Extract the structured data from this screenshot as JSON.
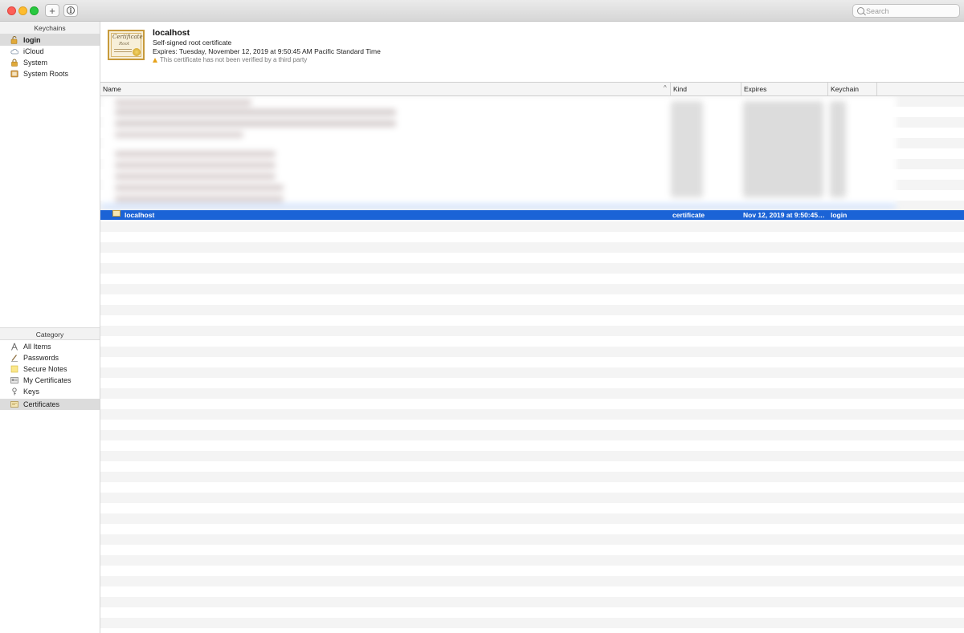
{
  "titlebar": {
    "search_placeholder": "Search"
  },
  "sidebar": {
    "keychains_header": "Keychains",
    "keychains": [
      {
        "label": "login",
        "icon": "lock-open-icon",
        "selected": true
      },
      {
        "label": "iCloud",
        "icon": "cloud-icon",
        "selected": false
      },
      {
        "label": "System",
        "icon": "lock-icon",
        "selected": false
      },
      {
        "label": "System Roots",
        "icon": "cabinet-icon",
        "selected": false
      }
    ],
    "category_header": "Category",
    "categories": [
      {
        "label": "All Items",
        "icon": "all-items-icon",
        "selected": false
      },
      {
        "label": "Passwords",
        "icon": "pen-icon",
        "selected": false
      },
      {
        "label": "Secure Notes",
        "icon": "note-icon",
        "selected": false
      },
      {
        "label": "My Certificates",
        "icon": "id-card-icon",
        "selected": false
      },
      {
        "label": "Keys",
        "icon": "key-icon",
        "selected": false
      },
      {
        "label": "Certificates",
        "icon": "certificate-icon",
        "selected": true
      }
    ]
  },
  "cert_header": {
    "title": "localhost",
    "type": "Self-signed root certificate",
    "expires": "Expires: Tuesday, November 12, 2019 at 9:50:45 AM Pacific Standard Time",
    "warning": "This certificate has not been verified by a third party",
    "warning_color": "#e6a21a"
  },
  "table": {
    "columns": [
      "Name",
      "Kind",
      "Expires",
      "Keychain"
    ],
    "sort_indicator": "^",
    "selected_row": {
      "name": "localhost",
      "kind": "certificate",
      "expires": "Nov 12, 2019 at 9:50:45…",
      "keychain": "login"
    }
  },
  "colors": {
    "selection": "#1b63d6",
    "traffic_close": "#fd5f57",
    "traffic_min": "#febc2e",
    "traffic_max": "#28c840"
  }
}
